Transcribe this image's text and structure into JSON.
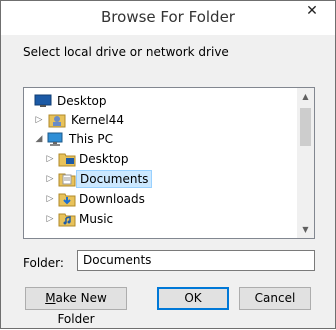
{
  "window": {
    "title": "Browse For Folder",
    "close_glyph": "✕"
  },
  "instruction": "Select local drive or network drive",
  "tree": {
    "items": [
      {
        "label": "Desktop",
        "icon": "desktop-icon",
        "arrow": "",
        "selected": false
      },
      {
        "label": "Kernel44",
        "icon": "user-icon",
        "arrow": "▷",
        "selected": false
      },
      {
        "label": "This PC",
        "icon": "computer-icon",
        "arrow": "◢",
        "selected": false
      },
      {
        "label": "Desktop",
        "icon": "folder-desktop-icon",
        "arrow": "▷",
        "selected": false
      },
      {
        "label": "Documents",
        "icon": "documents-folder-icon",
        "arrow": "▷",
        "selected": true
      },
      {
        "label": "Downloads",
        "icon": "downloads-folder-icon",
        "arrow": "▷",
        "selected": false
      },
      {
        "label": "Music",
        "icon": "music-folder-icon",
        "arrow": "▷",
        "selected": false
      }
    ],
    "scroll_up_glyph": "▲",
    "scroll_down_glyph": "▼"
  },
  "folder": {
    "label": "Folder:",
    "value": "Documents"
  },
  "buttons": {
    "make_new_folder_mnemonic": "M",
    "make_new_folder_rest": "ake New Folder",
    "ok": "OK",
    "cancel": "Cancel"
  },
  "colors": {
    "selection_bg": "#cce8ff",
    "selection_border": "#99d1ff",
    "default_button_border": "#0078d7",
    "folder_yellow": "#e8c25a"
  }
}
